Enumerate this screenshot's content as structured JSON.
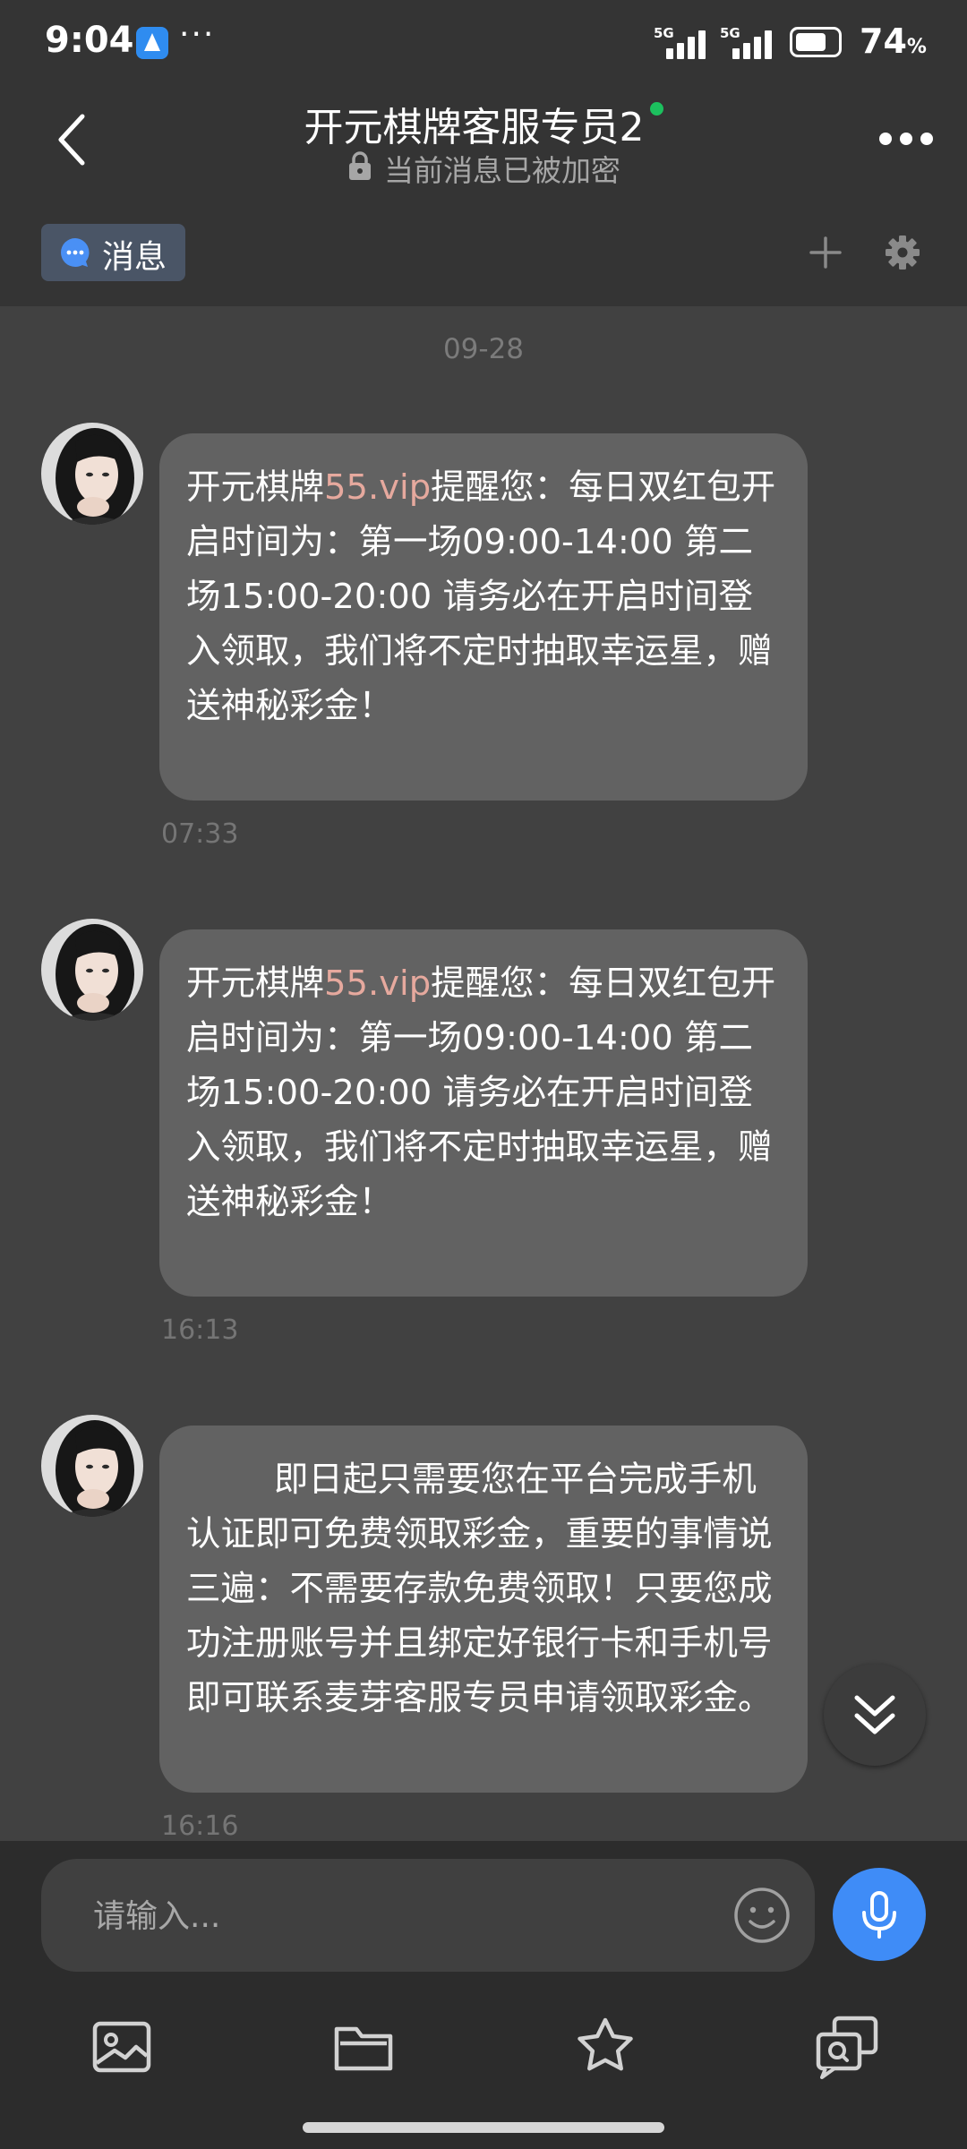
{
  "status_bar": {
    "time": "9:04",
    "app_icon": "navigation-arrow-icon",
    "more": "···",
    "network_tags": [
      "5G",
      "5G"
    ],
    "battery_level": 0.74,
    "battery_percent": "74",
    "battery_unit": "%"
  },
  "header": {
    "title": "开元棋牌客服专员2",
    "online_color": "#1cc05e",
    "subtitle": "当前消息已被加密",
    "tab_label": "消息"
  },
  "chat": {
    "date_separator": "09-28",
    "messages": [
      {
        "text_before": "开元棋牌",
        "link": "55.vip",
        "text_after": "提醒您：每日双红包开启时间为：第一场09:00-14:00 第二场15:00-20:00 请务必在开启时间登入领取，我们将不定时抽取幸运星，赠送神秘彩金！",
        "time": "07:33"
      },
      {
        "text_before": "开元棋牌",
        "link": "55.vip",
        "text_after": "提醒您：每日双红包开启时间为：第一场09:00-14:00 第二场15:00-20:00 请务必在开启时间登入领取，我们将不定时抽取幸运星，赠送神秘彩金！",
        "time": "16:13"
      },
      {
        "text": "        即日起只需要您在平台完成手机认证即可免费领取彩金，重要的事情说三遍：不需要存款免费领取！只要您成功注册账号并且绑定好银行卡和手机号即可联系麦芽客服专员申请领取彩金。",
        "time": "16:16"
      }
    ]
  },
  "input": {
    "placeholder": "请输入..."
  },
  "colors": {
    "accent": "#3f8cf7",
    "link": "#e6a99e",
    "bubble": "#626262",
    "background": "#414141"
  },
  "icons": {
    "back": "back-arrow-icon",
    "more": "more-dots-icon",
    "lock": "lock-icon",
    "message_tab": "chat-bubble-icon",
    "add": "plus-icon",
    "settings": "gear-icon",
    "scroll_down": "double-chevron-down-icon",
    "emoji": "smiley-icon",
    "mic": "microphone-icon",
    "toolbar": [
      "image-icon",
      "folder-icon",
      "star-icon",
      "quick-reply-icon"
    ]
  }
}
